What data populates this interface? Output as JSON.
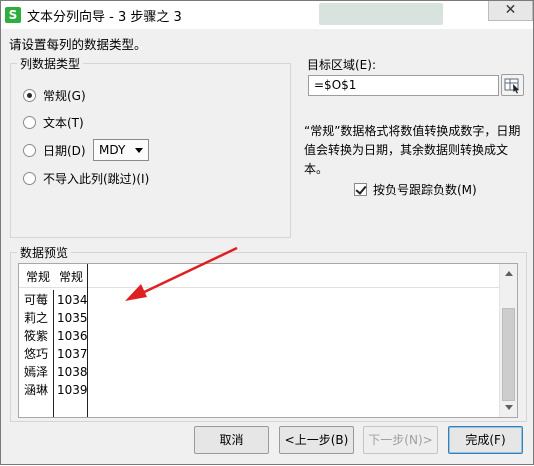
{
  "window": {
    "title": "文本分列向导 - 3 步骤之 3",
    "app_icon_letter": "S",
    "close_glyph": "✕"
  },
  "instruction": "请设置每列的数据类型。",
  "column_type": {
    "title": "列数据类型",
    "options": [
      {
        "label": "常规(G)",
        "checked": true
      },
      {
        "label": "文本(T)",
        "checked": false
      },
      {
        "label": "日期(D)",
        "checked": false
      },
      {
        "label": "不导入此列(跳过)(I)",
        "checked": false
      }
    ],
    "date_format": "MDY"
  },
  "target": {
    "label": "目标区域(E):",
    "value": "=$O$1"
  },
  "description": "“常规”数据格式将数值转换成数字，日期值会转换为日期，其余数据则转换成文本。",
  "negative_checkbox": {
    "label": "按负号跟踪负数(M)",
    "checked": true
  },
  "preview": {
    "title": "数据预览",
    "headers": [
      "常规",
      "常规"
    ],
    "rows": [
      [
        "可莓",
        "1034"
      ],
      [
        "莉之",
        "1035"
      ],
      [
        "筱紫",
        "1036"
      ],
      [
        "悠巧",
        "1037"
      ],
      [
        "嫣泽",
        "1038"
      ],
      [
        "涵琳",
        "1039"
      ]
    ]
  },
  "buttons": {
    "cancel": "取消",
    "back": "<上一步(B)",
    "next": "下一步(N)>",
    "finish": "完成(F)"
  },
  "colors": {
    "annotation_arrow": "#e02020",
    "app_icon": "#2fae3f"
  }
}
